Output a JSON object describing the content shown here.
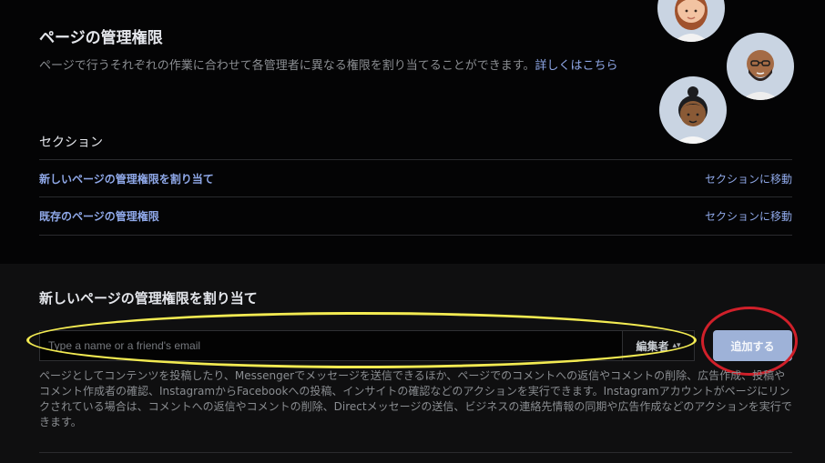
{
  "header": {
    "title": "ページの管理権限",
    "description": "ページで行うそれぞれの作業に合わせて各管理者に異なる権限を割り当てることができます。",
    "learn_more": "詳しくはこちら"
  },
  "avatars": [
    {
      "icon": "person-avatar-icon"
    },
    {
      "icon": "person-avatar-icon"
    },
    {
      "icon": "person-avatar-icon"
    }
  ],
  "sections": {
    "heading": "セクション",
    "items": [
      {
        "label": "新しいページの管理権限を割り当て",
        "action": "セクションに移動"
      },
      {
        "label": "既存のページの管理権限",
        "action": "セクションに移動"
      }
    ]
  },
  "assign": {
    "heading": "新しいページの管理権限を割り当て",
    "input_placeholder": "Type a name or a friend's email",
    "role_value": "編集者",
    "add_button": "追加する",
    "help_text": "ページとしてコンテンツを投稿したり、Messengerでメッセージを送信できるほか、ページでのコメントへの返信やコメントの削除、広告作成、投稿やコメント作成者の確認、InstagramからFacebookへの投稿、インサイトの確認などのアクションを実行できます。Instagramアカウントがページにリンクされている場合は、コメントへの返信やコメントの削除、Directメッセージの送信、ビジネスの連絡先情報の同期や広告作成などのアクションを実行できます。"
  },
  "colors": {
    "accent_link": "#8fa8e8",
    "add_button": "#9eb2d8",
    "highlight_yellow": "#f3eb52",
    "highlight_red": "#d0202a"
  }
}
